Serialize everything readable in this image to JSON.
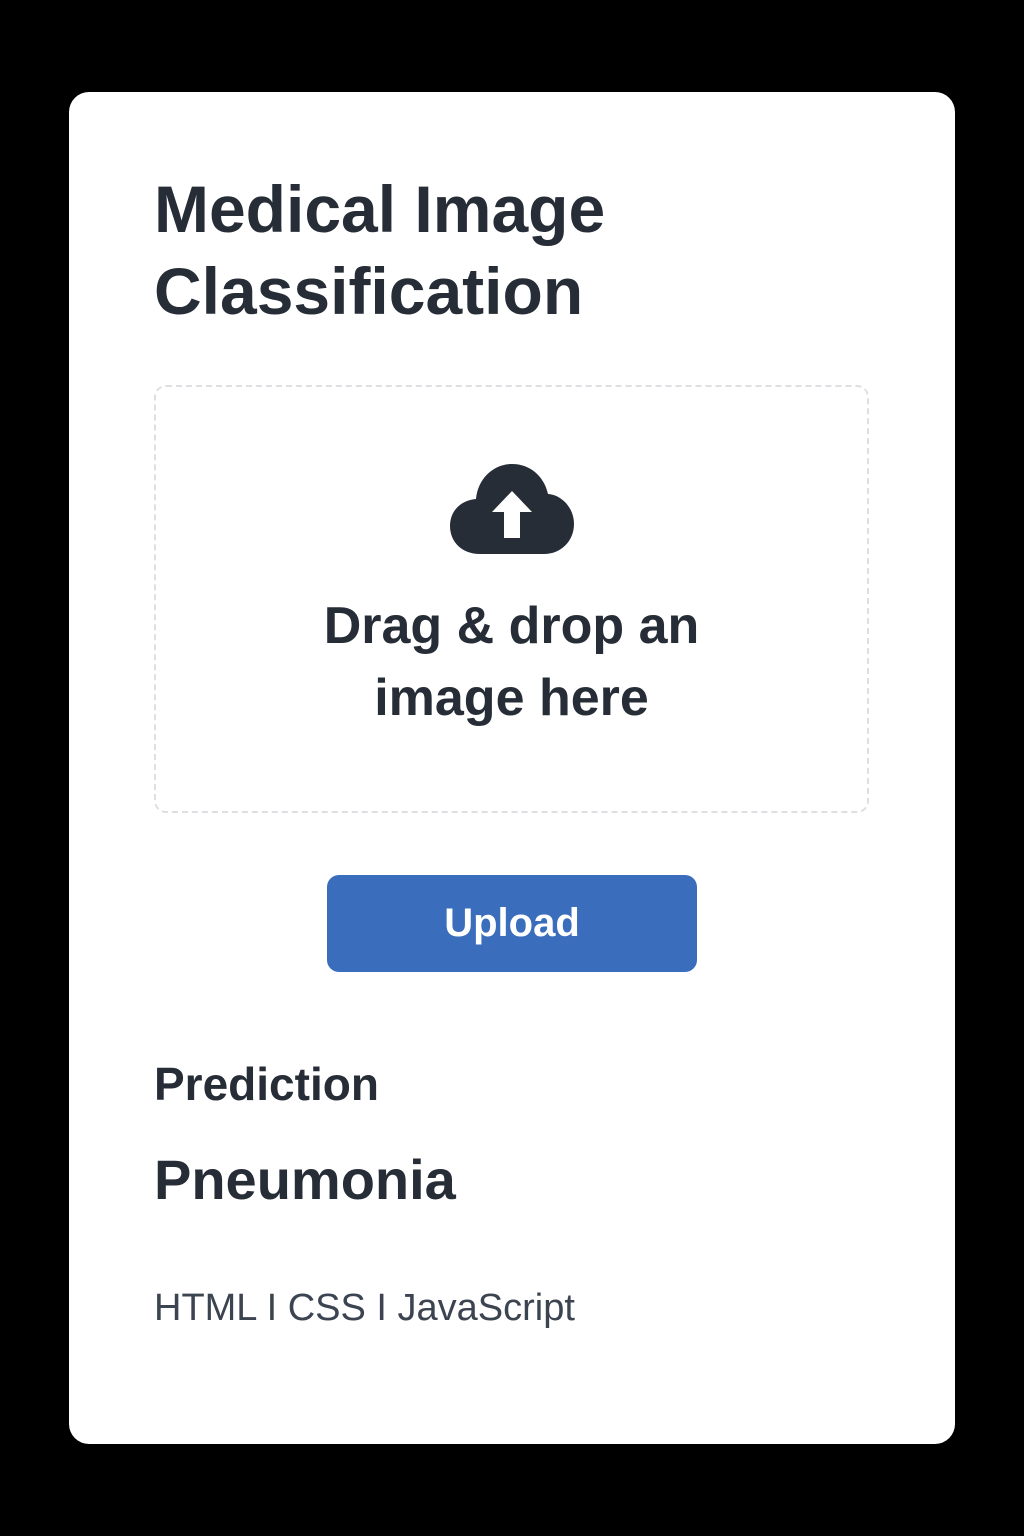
{
  "app": {
    "title": "Medical Image Classification"
  },
  "dropzone": {
    "icon": "cloud-upload-icon",
    "text": "Drag & drop an image here"
  },
  "upload": {
    "label": "Upload"
  },
  "prediction": {
    "label": "Prediction",
    "value": "Pneumonia"
  },
  "footer": {
    "tech": "HTML I CSS I JavaScript"
  },
  "colors": {
    "background": "#000000",
    "card": "#ffffff",
    "text": "#272d36",
    "accent": "#3a6dbc",
    "dropzone_border": "#dddfe3"
  }
}
